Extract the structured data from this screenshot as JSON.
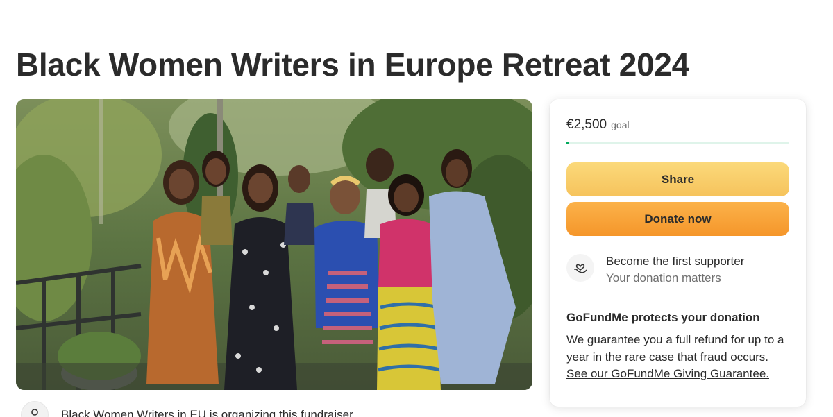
{
  "page": {
    "title": "Black Women Writers in Europe Retreat 2024"
  },
  "hero": {
    "alt": "Group photo of eight women standing in a garden"
  },
  "organizer": {
    "icon": "user-icon",
    "text": "Black Women Writers in EU is organizing this fundraiser."
  },
  "donation_card": {
    "goal_amount": "€2,500",
    "goal_label": "goal",
    "progress_fraction": 0.01,
    "share_label": "Share",
    "donate_label": "Donate now",
    "supporter_icon": "heart-hands-icon",
    "supporter_title": "Become the first supporter",
    "supporter_subtitle": "Your donation matters",
    "protect_title": "GoFundMe protects your donation",
    "protect_text": "We guarantee you a full refund for up to a year in the rare case that fraud occurs.",
    "protect_link": "See our GoFundMe Giving Guarantee."
  },
  "colors": {
    "progress_fill": "#02a95c",
    "progress_track": "#dff4ea",
    "share_button": "#f6c35c",
    "donate_button": "#f5962a",
    "text": "#2b2b2b",
    "muted_text": "#6f6f6f"
  }
}
